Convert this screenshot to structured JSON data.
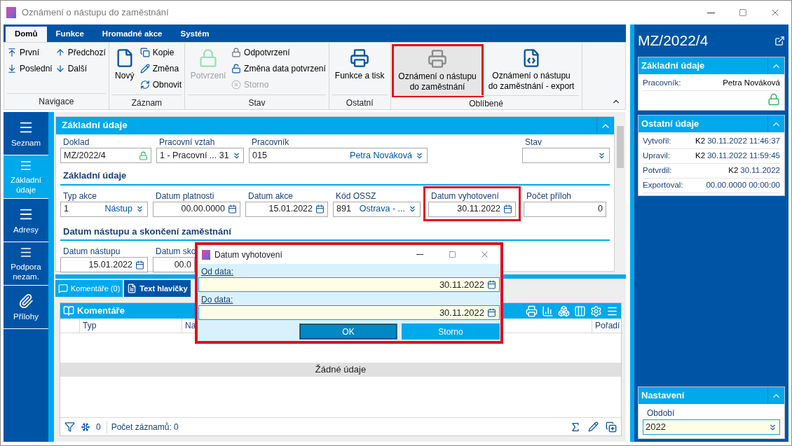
{
  "window": {
    "title": "Oznámení o nástupu do zaměstnání"
  },
  "ribbon": {
    "tabs": [
      {
        "label": "Domů",
        "selected": true
      },
      {
        "label": "Funkce",
        "selected": false
      },
      {
        "label": "Hromadné akce",
        "selected": false
      },
      {
        "label": "Systém",
        "selected": false
      }
    ],
    "groups": [
      {
        "label": "Navigace",
        "items": [
          {
            "kind": "small",
            "label": "První",
            "disabled": false
          },
          {
            "kind": "small",
            "label": "Poslední",
            "disabled": false
          },
          {
            "kind": "small",
            "label": "Předchozí",
            "disabled": false
          },
          {
            "kind": "small",
            "label": "Další",
            "disabled": false
          }
        ]
      },
      {
        "label": "Záznam",
        "items": [
          {
            "kind": "large",
            "label": "Nový",
            "disabled": false,
            "highlighted": false
          },
          {
            "kind": "small",
            "label": "Kopie",
            "disabled": false
          },
          {
            "kind": "small",
            "label": "Změna",
            "disabled": false
          },
          {
            "kind": "small",
            "label": "Obnovit",
            "disabled": false
          }
        ]
      },
      {
        "label": "Stav",
        "items": [
          {
            "kind": "large",
            "label": "Potvrzení",
            "disabled": true,
            "highlighted": false
          },
          {
            "kind": "small",
            "label": "Odpotvrzení",
            "disabled": false
          },
          {
            "kind": "small",
            "label": "Změna data potvrzení",
            "disabled": false
          },
          {
            "kind": "small",
            "label": "Storno",
            "disabled": true
          }
        ]
      },
      {
        "label": "Ostatní",
        "items": [
          {
            "kind": "large",
            "label": "Funkce a tisk",
            "disabled": false,
            "highlighted": false
          }
        ]
      },
      {
        "label": "Oblíbené",
        "items": [
          {
            "kind": "large",
            "label": "Oznámení o nástupu do zaměstnání",
            "disabled": false,
            "highlighted": true
          },
          {
            "kind": "large",
            "label": "Oznámení o nástupu do zaměstnání - export",
            "disabled": false,
            "highlighted": false
          }
        ]
      }
    ]
  },
  "nav": [
    {
      "label": "Seznam",
      "selected": false
    },
    {
      "label": "Základní údaje",
      "selected": true
    },
    {
      "label": "Adresy",
      "selected": false
    },
    {
      "label": "Podpora nezam.",
      "selected": false
    },
    {
      "label": "Přílohy",
      "selected": false
    }
  ],
  "form": {
    "title": "Základní údaje",
    "rows": [
      {
        "fields": [
          {
            "label": "Doklad",
            "kind": "locked",
            "value": "MZ/2022/4",
            "highlighted": false
          },
          {
            "label": "Pracovní vztah",
            "kind": "dropdown",
            "value": "1 - Pracovní ... 31",
            "highlighted": false
          },
          {
            "label": "Pracovník",
            "kind": "dropdown",
            "value": "015",
            "value2": "Petra Nováková",
            "highlighted": false
          },
          {
            "label": "Stav",
            "kind": "dropdown",
            "highlighted": false
          }
        ]
      },
      {
        "section": "Základní údaje",
        "fields": [
          {
            "label": "Typ akce",
            "kind": "dropdown",
            "value": "1",
            "value2": "Nástup",
            "highlighted": false
          },
          {
            "label": "Datum platnosti",
            "kind": "date",
            "value": "00.00.0000",
            "highlighted": false
          },
          {
            "label": "Datum akce",
            "kind": "date",
            "value": "15.01.2022",
            "highlighted": false
          },
          {
            "label": "Kód OSSZ",
            "kind": "dropdown",
            "value": "891",
            "value2": "Ostrava - ...",
            "highlighted": false
          },
          {
            "label": "Datum vyhotovení",
            "kind": "date",
            "value": "30.11.2022",
            "highlighted": true
          },
          {
            "label": "Počet příloh",
            "kind": "number",
            "value": "0",
            "highlighted": false
          }
        ]
      },
      {
        "section": "Datum nástupu a skončení zaměstnání",
        "fields": [
          {
            "label": "Datum nástupu",
            "kind": "date",
            "value": "15.01.2022",
            "highlighted": false
          },
          {
            "label": "Datum sko",
            "kind": "clipped",
            "value": "00.0",
            "highlighted": false
          }
        ]
      }
    ]
  },
  "bottom_tabs": [
    {
      "label": "Komentáře (0)",
      "selected": true
    },
    {
      "label": "Text hlavičky",
      "selected": false
    }
  ],
  "grid": {
    "title": "Komentáře",
    "columns": [
      "Typ",
      "Na",
      "Pořadí"
    ],
    "empty": "Žádné údaje",
    "footer": {
      "filtered": "0",
      "count": "Počet záznamů: 0"
    }
  },
  "dialog": {
    "title": "Datum vyhotovení",
    "highlighted": true,
    "fields": [
      {
        "label": "Od data:",
        "value": "30.11.2022"
      },
      {
        "label": "Do data:",
        "value": "30.11.2022"
      }
    ],
    "buttons": [
      {
        "label": "OK",
        "focused": true
      },
      {
        "label": "Storno",
        "focused": false
      }
    ]
  },
  "side": {
    "title": "MZ/2022/4",
    "sections": [
      {
        "title": "Základní údaje",
        "rows": [
          {
            "label": "Pracovník:",
            "value": "Petra Nováková"
          }
        ],
        "locked": true
      },
      {
        "title": "Ostatní údaje",
        "rows": [
          {
            "label": "Vytvořil:",
            "prefix": "K2",
            "value": "30.11.2022 11:46:37"
          },
          {
            "label": "Upravil:",
            "prefix": "K2",
            "value": "30.11.2022 11:59:45"
          },
          {
            "label": "Potvrdil:",
            "prefix": "K2",
            "value": "30.11.2022"
          },
          {
            "label": "Exportoval:",
            "value": "00.00.0000 00:00:00"
          }
        ],
        "locked": false
      }
    ],
    "settings": {
      "title": "Nastavení",
      "label": "Období",
      "value": "2022"
    }
  }
}
